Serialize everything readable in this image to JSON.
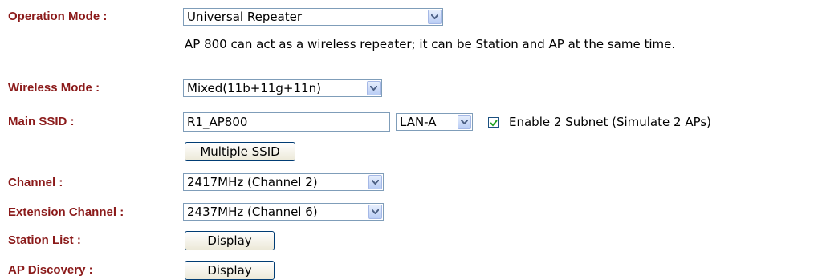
{
  "operation_mode": {
    "label": "Operation Mode :",
    "value": "Universal Repeater",
    "description": "AP 800 can act as a wireless repeater; it can be Station and AP at the same time."
  },
  "wireless_mode": {
    "label": "Wireless Mode :",
    "value": "Mixed(11b+11g+11n)"
  },
  "main_ssid": {
    "label": "Main SSID :",
    "value": "R1_AP800",
    "lan_value": "LAN-A",
    "enable_subnet_label": "Enable 2 Subnet (Simulate 2 APs)",
    "enable_subnet_checked": true,
    "multiple_ssid_button": "Multiple SSID"
  },
  "channel": {
    "label": "Channel :",
    "value": "2417MHz (Channel 2)"
  },
  "extension_channel": {
    "label": "Extension Channel :",
    "value": "2437MHz (Channel 6)"
  },
  "station_list": {
    "label": "Station List :",
    "button": "Display"
  },
  "ap_discovery": {
    "label": "AP Discovery :",
    "button": "Display"
  },
  "colors": {
    "label": "#8b1a1a",
    "field_border": "#7f9db9",
    "check": "#21a121"
  }
}
